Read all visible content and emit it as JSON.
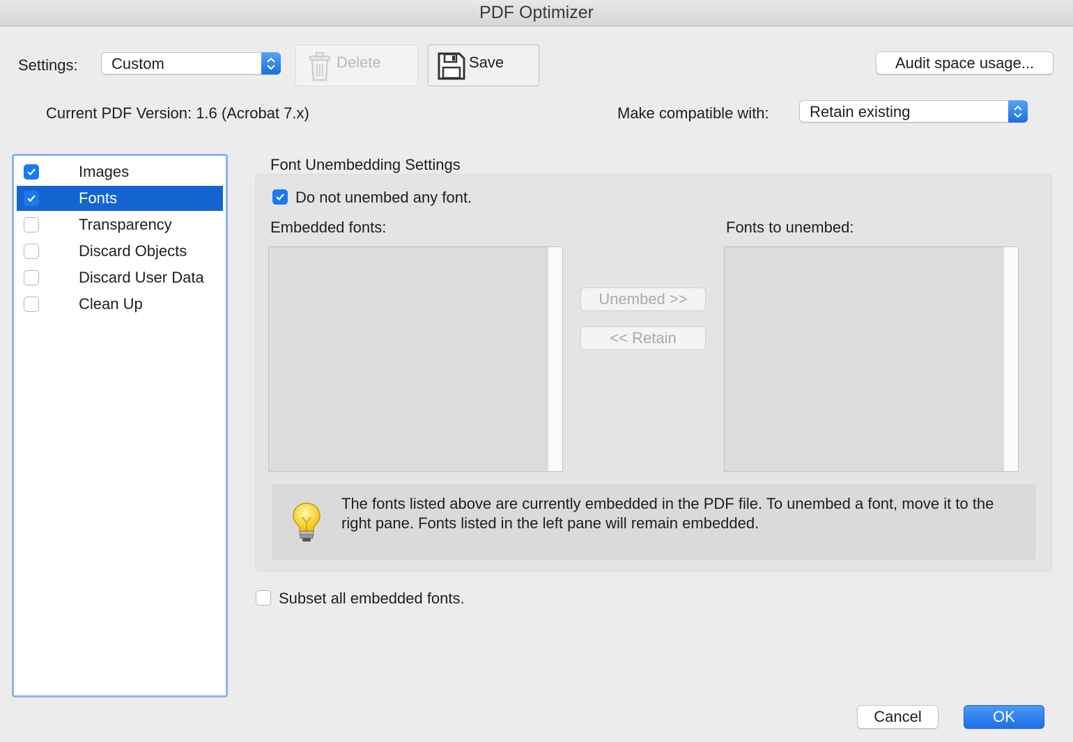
{
  "window": {
    "title": "PDF Optimizer"
  },
  "settings": {
    "label": "Settings:",
    "value": "Custom",
    "delete_label": "Delete",
    "save_label": "Save",
    "audit_label": "Audit space usage..."
  },
  "version": {
    "current": "Current PDF Version: 1.6 (Acrobat 7.x)",
    "compat_label": "Make compatible with:",
    "compat_value": "Retain existing"
  },
  "sidebar": {
    "items": [
      {
        "label": "Images",
        "checked": true,
        "selected": false
      },
      {
        "label": "Fonts",
        "checked": true,
        "selected": true
      },
      {
        "label": "Transparency",
        "checked": false,
        "selected": false
      },
      {
        "label": "Discard Objects",
        "checked": false,
        "selected": false
      },
      {
        "label": "Discard User Data",
        "checked": false,
        "selected": false
      },
      {
        "label": "Clean Up",
        "checked": false,
        "selected": false
      }
    ]
  },
  "fonts_panel": {
    "section_title": "Font Unembedding Settings",
    "no_unembed_label": "Do not unembed any font.",
    "no_unembed_checked": true,
    "embedded_label": "Embedded fonts:",
    "unembed_list_label": "Fonts to unembed:",
    "unembed_btn": "Unembed >>",
    "retain_btn": "<< Retain",
    "info_text": "The fonts listed above are currently embedded in the PDF file. To unembed a font, move it to the right pane. Fonts listed in the left pane will remain embedded.",
    "subset_label": "Subset all embedded fonts.",
    "subset_checked": false
  },
  "footer": {
    "cancel_label": "Cancel",
    "ok_label": "OK"
  },
  "colors": {
    "accent": "#1b78f2",
    "selection": "#1464d2",
    "ok_button": "#2a7cf0"
  },
  "icons": [
    "trash-icon",
    "floppy-disk-icon",
    "lightbulb-icon",
    "popup-stepper-icon",
    "checkmark-icon"
  ]
}
